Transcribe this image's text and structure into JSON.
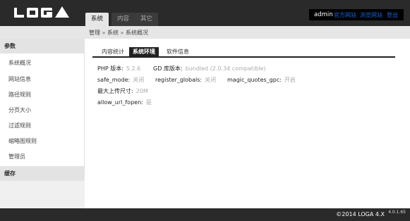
{
  "header": {
    "nav_tabs": [
      {
        "label": "系统"
      },
      {
        "label": "内容"
      },
      {
        "label": "其它"
      }
    ],
    "user": {
      "name": "admin",
      "links": [
        "官方网站",
        "浏览网站",
        "登出"
      ]
    }
  },
  "breadcrumb": [
    "管理",
    "系统",
    "系统概况"
  ],
  "sidebar": {
    "sections": [
      {
        "title": "参数",
        "items": [
          "系统概况",
          "网站信息",
          "路径规则",
          "分页大小",
          "过滤规则",
          "缩略图规则",
          "管理员"
        ]
      },
      {
        "title": "缓存",
        "items": []
      }
    ]
  },
  "main": {
    "tabs": [
      "内容统计",
      "系统环境",
      "软件信息"
    ],
    "env": [
      {
        "key": "PHP 版本:",
        "value": "5.2.6"
      },
      {
        "key": "GD 库版本:",
        "value": "bundled (2.0.34 compatible)"
      },
      {
        "key": "safe_mode:",
        "value": "关闭"
      },
      {
        "key": "register_globals:",
        "value": "关闭"
      },
      {
        "key": "magic_quotes_gpc:",
        "value": "开启"
      },
      {
        "key": "最大上传尺寸:",
        "value": "20M"
      },
      {
        "key": "allow_url_fopen:",
        "value": "是"
      }
    ]
  },
  "footer": {
    "copyright": "©2014 LOGA 4.X",
    "version": "4.0.1.65"
  },
  "colors": {
    "header_bg": "#2a2a2a",
    "link_blue": "#1e63d6",
    "value_gray": "#aaaaaa"
  }
}
